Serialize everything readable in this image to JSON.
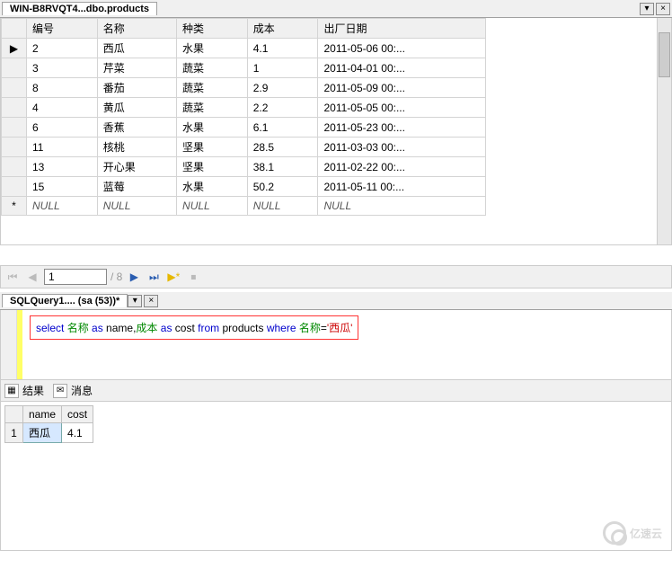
{
  "topTab": {
    "title": "WIN-B8RVQT4...dbo.products"
  },
  "grid": {
    "headers": [
      "编号",
      "名称",
      "种类",
      "成本",
      "出厂日期"
    ],
    "rows": [
      {
        "sel": "▶",
        "cells": [
          "2",
          "西瓜",
          "水果",
          "4.1",
          "2011-05-06 00:..."
        ]
      },
      {
        "sel": "",
        "cells": [
          "3",
          "芹菜",
          "蔬菜",
          "1",
          "2011-04-01 00:..."
        ]
      },
      {
        "sel": "",
        "cells": [
          "8",
          "番茄",
          "蔬菜",
          "2.9",
          "2011-05-09 00:..."
        ]
      },
      {
        "sel": "",
        "cells": [
          "4",
          "黄瓜",
          "蔬菜",
          "2.2",
          "2011-05-05 00:..."
        ]
      },
      {
        "sel": "",
        "cells": [
          "6",
          "香蕉",
          "水果",
          "6.1",
          "2011-05-23 00:..."
        ]
      },
      {
        "sel": "",
        "cells": [
          "11",
          "核桃",
          "坚果",
          "28.5",
          "2011-03-03 00:..."
        ]
      },
      {
        "sel": "",
        "cells": [
          "13",
          "开心果",
          "坚果",
          "38.1",
          "2011-02-22 00:..."
        ]
      },
      {
        "sel": "",
        "cells": [
          "15",
          "蓝莓",
          "水果",
          "50.2",
          "2011-05-11 00:..."
        ]
      }
    ],
    "nullRow": {
      "sel": "*",
      "cells": [
        "NULL",
        "NULL",
        "NULL",
        "NULL",
        "NULL"
      ]
    }
  },
  "pager": {
    "current": "1",
    "total": "/ 8"
  },
  "queryTab": {
    "title": "SQLQuery1.... (sa (53))*"
  },
  "sql": {
    "t1": "select ",
    "c1": "名称",
    "t2": " as ",
    "c2": "name",
    "t3": ",",
    "c3": "成本",
    "t4": " as ",
    "c4": "cost",
    "t5": " from ",
    "c5": "products",
    "t6": " where ",
    "c6": "名称",
    "t7": "=",
    "s1": "'西瓜'"
  },
  "resultsTabs": {
    "results": "结果",
    "messages": "消息"
  },
  "results": {
    "headers": [
      "name",
      "cost"
    ],
    "rows": [
      {
        "num": "1",
        "cells": [
          "西瓜",
          "4.1"
        ]
      }
    ]
  },
  "watermark": "亿速云"
}
